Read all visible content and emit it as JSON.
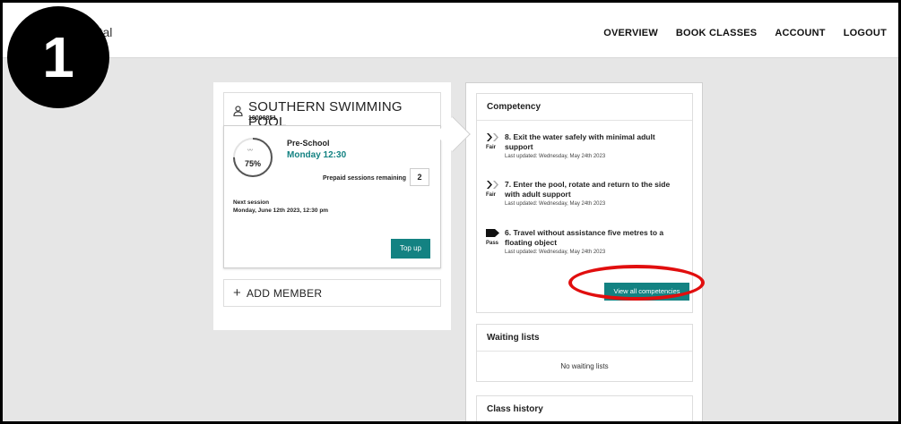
{
  "step_number": "1",
  "header": {
    "brand": "Leisure Portal",
    "nav": [
      "OVERVIEW",
      "BOOK CLASSES",
      "ACCOUNT",
      "LOGOUT"
    ]
  },
  "member": {
    "pool_name": "SOUTHERN SWIMMING POOL",
    "member_id": "10000851",
    "progress_percent": "75%",
    "progress_fraction": 0.75,
    "class_level": "Pre-School",
    "class_time": "Monday 12:30",
    "prepaid_label": "Prepaid sessions remaining",
    "prepaid_count": "2",
    "next_session_label": "Next session",
    "next_session_value": "Monday, June 12th 2023, 12:30 pm",
    "top_up_label": "Top up",
    "add_member_label": "ADD MEMBER"
  },
  "competency": {
    "title": "Competency",
    "items": [
      {
        "status": "Fair",
        "text": "8. Exit the water safely with minimal adult support",
        "date": "Last updated: Wednesday, May 24th 2023"
      },
      {
        "status": "Fair",
        "text": "7. Enter the pool, rotate and return to the side with adult support",
        "date": "Last updated: Wednesday, May 24th 2023"
      },
      {
        "status": "Pass",
        "text": "6. Travel without assistance five metres to a floating object",
        "date": "Last updated: Wednesday, May 24th 2023"
      }
    ],
    "view_all_label": "View all competencies"
  },
  "waiting_lists": {
    "title": "Waiting lists",
    "empty_text": "No waiting lists"
  },
  "class_history": {
    "title": "Class history"
  },
  "colors": {
    "accent": "#138282",
    "highlight": "#e10e0e"
  }
}
